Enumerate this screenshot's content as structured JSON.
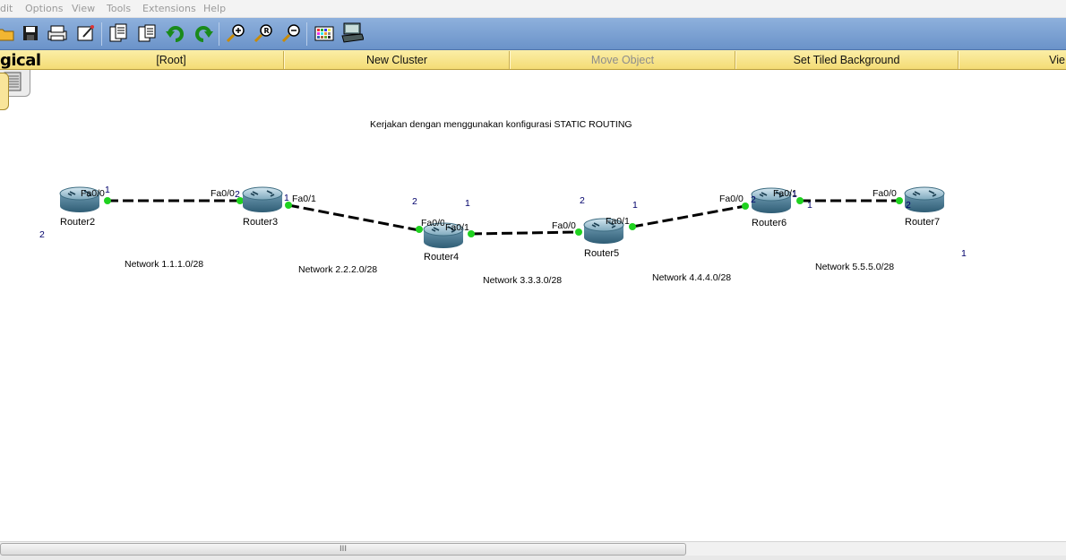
{
  "menu": [
    "dit",
    "Options",
    "View",
    "Tools",
    "Extensions",
    "Help"
  ],
  "toolbar": {
    "buttons": [
      "open-icon",
      "save-icon",
      "print-icon",
      "activity-wizard-icon",
      "copy-icon",
      "paste-icon",
      "undo-icon",
      "redo-icon",
      "zoom-in-icon",
      "zoom-reset-icon",
      "zoom-out-icon",
      "palette-icon",
      "custom-device-icon"
    ]
  },
  "logical_bar": {
    "title": "gical",
    "root": "[Root]",
    "new_cluster": "New Cluster",
    "move_object": "Move Object",
    "set_tiled_background": "Set Tiled Background",
    "viewport": "Vie"
  },
  "canvas": {
    "note": "Kerjakan dengan menggunakan konfigurasi STATIC ROUTING",
    "routers": [
      "Router2",
      "Router3",
      "Router4",
      "Router5",
      "Router6",
      "Router7"
    ],
    "networks": [
      "Network 1.1.1.0/28",
      "Network 2.2.2.0/28",
      "Network 3.3.3.0/28",
      "Network 4.4.4.0/28",
      "Network 5.5.5.0/28"
    ],
    "ports": {
      "r2_fa00": "Fa0/0",
      "r3_fa00": "Fa0/0",
      "r3_fa01": "Fa0/1",
      "r4_fa00": "Fa0/0",
      "r4_fa01": "Fa0/1",
      "r5_fa00": "Fa0/0",
      "r5_fa01": "Fa0/1",
      "r6_fa00": "Fa0/0",
      "r6_fa01": "Fa0/1",
      "r7_fa00": "Fa0/0"
    },
    "numbers": {
      "n1": "1",
      "n2": "2",
      "n3": "1",
      "n4": "2",
      "n5": "1",
      "n6": "2",
      "n7": "1",
      "n8": "2",
      "n9": "1",
      "n10": "2",
      "n11": "1",
      "n12": "2",
      "n13": "1"
    }
  },
  "scrollbar": {
    "grip": "III"
  },
  "colors": {
    "toolbar": "#7aa0d3",
    "logical_bar": "#f7e38a",
    "link_up": "#1fd21f"
  }
}
